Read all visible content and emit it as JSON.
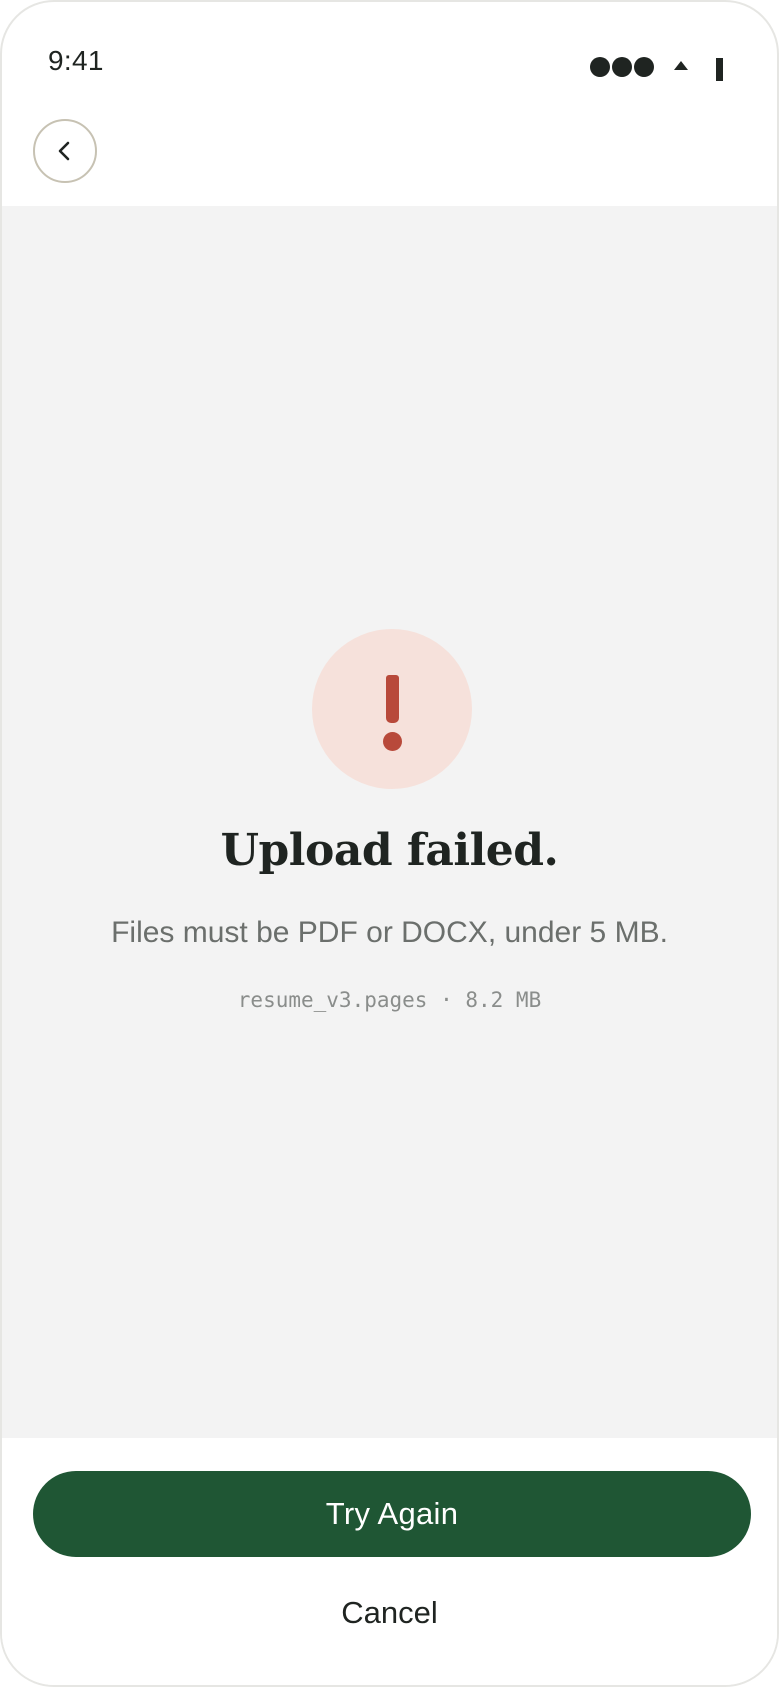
{
  "status_bar": {
    "time": "9:41"
  },
  "header": {
    "back_icon": "chevron-left-icon"
  },
  "error": {
    "icon": "exclamation-icon",
    "title": "Upload failed.",
    "message": "Files must be PDF or DOCX, under 5 MB.",
    "file_info": "resume_v3.pages · 8.2 MB"
  },
  "actions": {
    "primary_label": "Try Again",
    "secondary_label": "Cancel"
  },
  "colors": {
    "primary": "#1f5634",
    "error_accent": "#b8493a",
    "error_bg": "#f6e1db",
    "surface": "#f3f3f3",
    "text": "#1f2421"
  }
}
